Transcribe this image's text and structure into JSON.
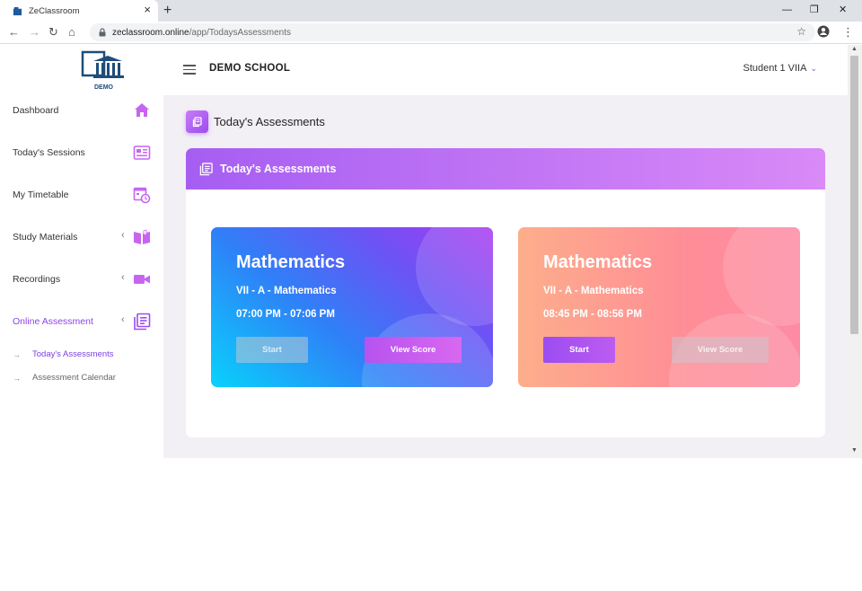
{
  "browser": {
    "tab_title": "ZeClassroom",
    "tab_close": "×",
    "new_tab": "+",
    "url_host": "zeclassroom.online",
    "url_path": "/app/TodaysAssessments",
    "minimize": "—",
    "restore": "❐",
    "close": "✕",
    "back": "←",
    "forward": "→",
    "reload": "↻",
    "home": "⌂",
    "star": "☆",
    "menu": "⋮"
  },
  "logo": {
    "text": "DEMO"
  },
  "header": {
    "school": "DEMO SCHOOL",
    "user": "Student 1 VIIA",
    "caret": "⌄"
  },
  "sidebar": {
    "items": [
      {
        "label": "Dashboard",
        "icon": "home-icon"
      },
      {
        "label": "Today's Sessions",
        "icon": "sessions-icon"
      },
      {
        "label": "My Timetable",
        "icon": "timetable-icon"
      },
      {
        "label": "Study Materials",
        "icon": "book-icon",
        "chevron": "‹"
      },
      {
        "label": "Recordings",
        "icon": "video-icon",
        "chevron": "‹"
      },
      {
        "label": "Online Assessment",
        "icon": "assessment-icon",
        "chevron": "‹"
      }
    ],
    "subitems": [
      {
        "label": "Today's Assessments",
        "arrow": "→"
      },
      {
        "label": "Assessment Calendar",
        "arrow": "→"
      }
    ]
  },
  "page": {
    "title": "Today's Assessments",
    "panel_title": "Today's Assessments"
  },
  "cards": [
    {
      "subject": "Mathematics",
      "class": "VII - A - Mathematics",
      "time": "07:00 PM - 07:06 PM",
      "start": "Start",
      "score": "View Score"
    },
    {
      "subject": "Mathematics",
      "class": "VII - A - Mathematics",
      "time": "08:45 PM - 08:56 PM",
      "start": "Start",
      "score": "View Score"
    }
  ],
  "colors": {
    "accent": "#8e44e8",
    "icon": "#c765f0",
    "panel_gradient_start": "#a65ef2",
    "panel_gradient_end": "#d98af7"
  }
}
